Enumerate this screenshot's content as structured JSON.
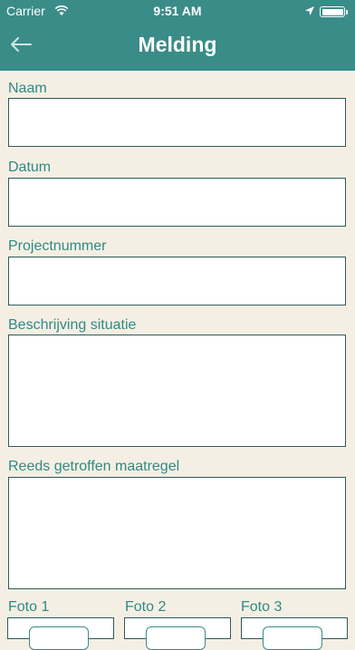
{
  "status_bar": {
    "carrier": "Carrier",
    "time": "9:51 AM"
  },
  "header": {
    "title": "Melding",
    "back_icon": "arrow-left-icon"
  },
  "form": {
    "naam_label": "Naam",
    "naam_value": "",
    "datum_label": "Datum",
    "datum_value": "",
    "projectnummer_label": "Projectnummer",
    "projectnummer_value": "",
    "beschrijving_label": "Beschrijving situatie",
    "beschrijving_value": "",
    "maatregel_label": "Reeds getroffen maatregel",
    "maatregel_value": ""
  },
  "photos": [
    {
      "label": "Foto 1"
    },
    {
      "label": "Foto 2"
    },
    {
      "label": "Foto 3"
    }
  ],
  "colors": {
    "header": "#3a8c88",
    "background": "#f5efe3",
    "label": "#2e8a86",
    "field_border": "#2d5a5a"
  }
}
